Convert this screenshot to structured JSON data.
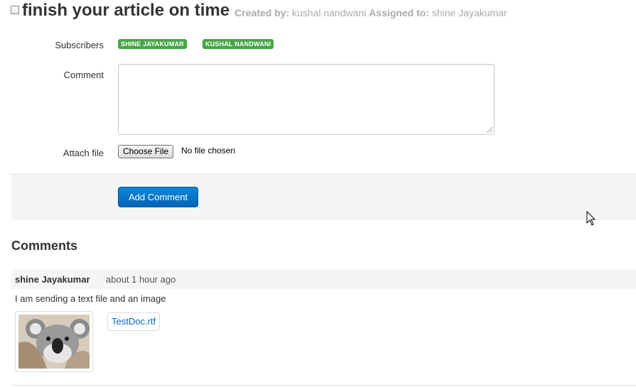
{
  "task": {
    "title": "finish your article on time",
    "created_by_label": "Created by:",
    "created_by": "kushal nandwani",
    "assigned_to_label": "Assigned to:",
    "assigned_to": "shine Jayakumar"
  },
  "form": {
    "subscribers_label": "Subscribers",
    "subscribers": [
      "SHINE JAYAKUMAR",
      "KUSHAL NANDWANI"
    ],
    "comment_label": "Comment",
    "comment_value": "",
    "attach_label": "Attach file",
    "choose_file_label": "Choose File",
    "file_status": "No file chosen",
    "submit_label": "Add Comment"
  },
  "comments": {
    "heading": "Comments",
    "items": [
      {
        "author": "shine Jayakumar",
        "time": "about 1 hour ago",
        "text": "I am sending a text file and an image",
        "attachment_file": "TestDoc.rtf"
      }
    ]
  },
  "colors": {
    "badge": "#46a546",
    "primary_button": "#0565b4",
    "link": "#0069d6"
  }
}
